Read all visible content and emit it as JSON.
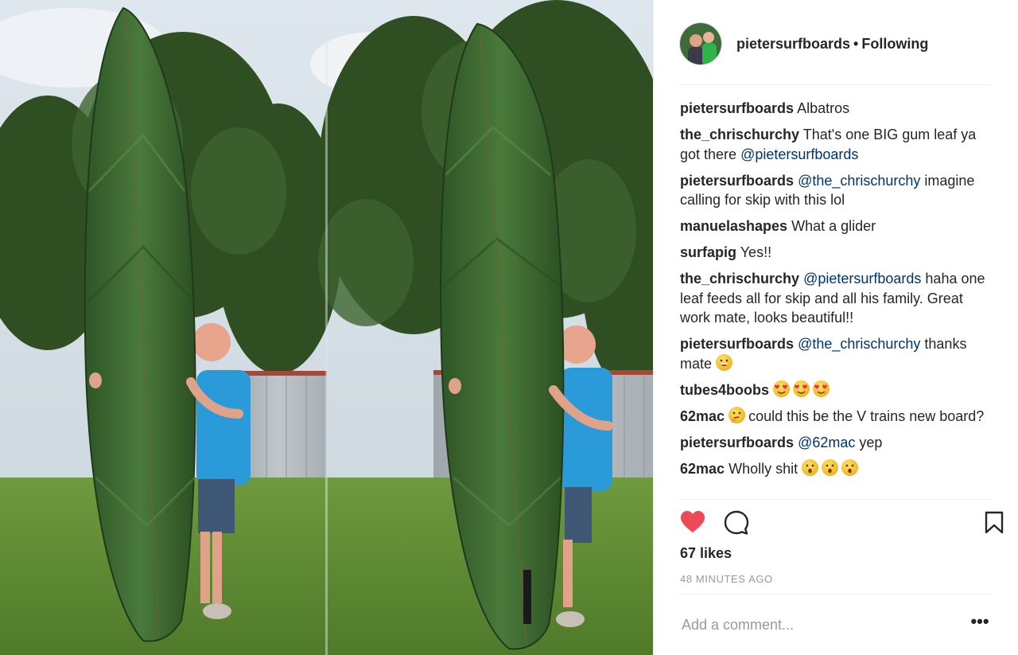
{
  "post": {
    "username": "pietersurfboards",
    "separator": "•",
    "follow_status": "Following",
    "caption": {
      "user": "pietersurfboards",
      "text": "Albatros"
    },
    "comments": [
      {
        "user": "the_chrischurchy",
        "parts": [
          {
            "t": "text",
            "v": "That's one BIG gum leaf ya got there "
          },
          {
            "t": "mention",
            "v": "@pietersurfboards"
          }
        ]
      },
      {
        "user": "pietersurfboards",
        "parts": [
          {
            "t": "mention",
            "v": "@the_chrischurchy"
          },
          {
            "t": "text",
            "v": " imagine calling for skip with this lol"
          }
        ]
      },
      {
        "user": "manuelashapes",
        "parts": [
          {
            "t": "text",
            "v": "What a glider"
          }
        ]
      },
      {
        "user": "surfapig",
        "parts": [
          {
            "t": "text",
            "v": "Yes!!"
          }
        ]
      },
      {
        "user": "the_chrischurchy",
        "parts": [
          {
            "t": "mention",
            "v": "@pietersurfboards"
          },
          {
            "t": "text",
            "v": " haha one leaf feeds all for skip and all his family. Great work mate, looks beautiful!!"
          }
        ]
      },
      {
        "user": "pietersurfboards",
        "parts": [
          {
            "t": "mention",
            "v": "@the_chrischurchy"
          },
          {
            "t": "text",
            "v": " thanks mate "
          },
          {
            "t": "emoji",
            "v": "grinning-face"
          }
        ]
      },
      {
        "user": "tubes4boobs",
        "parts": [
          {
            "t": "emoji",
            "v": "heart-eyes"
          },
          {
            "t": "emoji",
            "v": "heart-eyes"
          },
          {
            "t": "emoji",
            "v": "heart-eyes"
          }
        ]
      },
      {
        "user": "62mac",
        "parts": [
          {
            "t": "emoji",
            "v": "thinking-face"
          },
          {
            "t": "text",
            "v": "could this be the V trains new board?"
          }
        ]
      },
      {
        "user": "pietersurfboards",
        "parts": [
          {
            "t": "mention",
            "v": "@62mac"
          },
          {
            "t": "text",
            "v": " yep"
          }
        ]
      },
      {
        "user": "62mac",
        "parts": [
          {
            "t": "text",
            "v": "Wholly shit "
          },
          {
            "t": "emoji",
            "v": "hushed-face"
          },
          {
            "t": "emoji",
            "v": "hushed-face"
          },
          {
            "t": "emoji",
            "v": "hushed-face"
          }
        ]
      }
    ],
    "likes": "67 likes",
    "timestamp": "48 MINUTES AGO",
    "comment_placeholder": "Add a comment...",
    "more_label": "•••"
  },
  "icons": {
    "like": "heart-icon",
    "comment": "comment-icon",
    "save": "bookmark-icon",
    "more": "more-options-icon"
  },
  "colors": {
    "heart": "#ed4956",
    "mention": "#003569",
    "muted": "#999999",
    "divider": "#efefef",
    "board_green": "#3f6a30"
  }
}
